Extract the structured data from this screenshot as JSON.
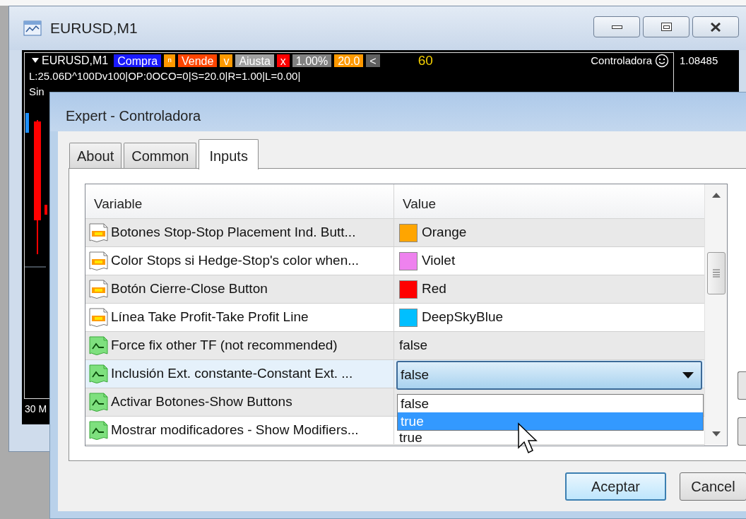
{
  "chart_window": {
    "title": "EURUSD,M1",
    "symbol": "EURUSD,M1",
    "toolbar": [
      {
        "label": "Compra",
        "color": "#1a1aff"
      },
      {
        "label": "ⁿ",
        "color": "#ff9900"
      },
      {
        "label": "Vende",
        "color": "#ff4500"
      },
      {
        "label": "v",
        "color": "#ff9900"
      },
      {
        "label": "Aiusta",
        "color": "#a0a0a0"
      },
      {
        "label": "x",
        "color": "#ff0000"
      },
      {
        "label": "1.00%",
        "color": "#808080"
      },
      {
        "label": "20.0",
        "color": "#ff9900"
      },
      {
        "label": "<",
        "color": "#606060"
      }
    ],
    "period": "60",
    "expert": "Controladora",
    "price": "1.08485",
    "status_line": "L:25.06D^100Dv100|OP:0OCO=0|S=20.0|R=1.00|L=0.00|",
    "line_3": "Sin",
    "time_label": "30 M"
  },
  "dialog": {
    "title": "Expert - Controladora",
    "tabs": [
      {
        "label": "About",
        "selected": false
      },
      {
        "label": "Common",
        "selected": false
      },
      {
        "label": "Inputs",
        "selected": true
      }
    ],
    "columns": [
      "Variable",
      "Value"
    ],
    "rows": [
      {
        "kind": "color",
        "name": "Botones Stop-Stop Placement Ind. Butt...",
        "value": "Orange",
        "color": "#ffa500",
        "selected": false
      },
      {
        "kind": "color",
        "name": "Color Stops si Hedge-Stop's color when...",
        "value": "Violet",
        "color": "#ee82ee",
        "selected": false
      },
      {
        "kind": "color",
        "name": "Botón Cierre-Close Button",
        "value": "Red",
        "color": "#ff0000",
        "selected": false
      },
      {
        "kind": "color",
        "name": "Línea Take Profit-Take Profit Line",
        "value": "DeepSkyBlue",
        "color": "#00bfff",
        "selected": false
      },
      {
        "kind": "bool",
        "name": "Force fix other TF (not recommended)",
        "value": "false",
        "selected": false
      },
      {
        "kind": "bool",
        "name": "Inclusión Ext. constante-Constant Ext. ...",
        "value": "false",
        "selected": true
      },
      {
        "kind": "bool",
        "name": "Activar Botones-Show Buttons",
        "selected": false
      },
      {
        "kind": "bool",
        "name": "Mostrar modificadores - Show Modifiers...",
        "value": "true",
        "selected": false
      }
    ],
    "dropdown_options": [
      {
        "label": "false",
        "selected": false
      },
      {
        "label": "true",
        "selected": true
      }
    ],
    "buttons": [
      "Aceptar",
      "Cancel"
    ]
  }
}
